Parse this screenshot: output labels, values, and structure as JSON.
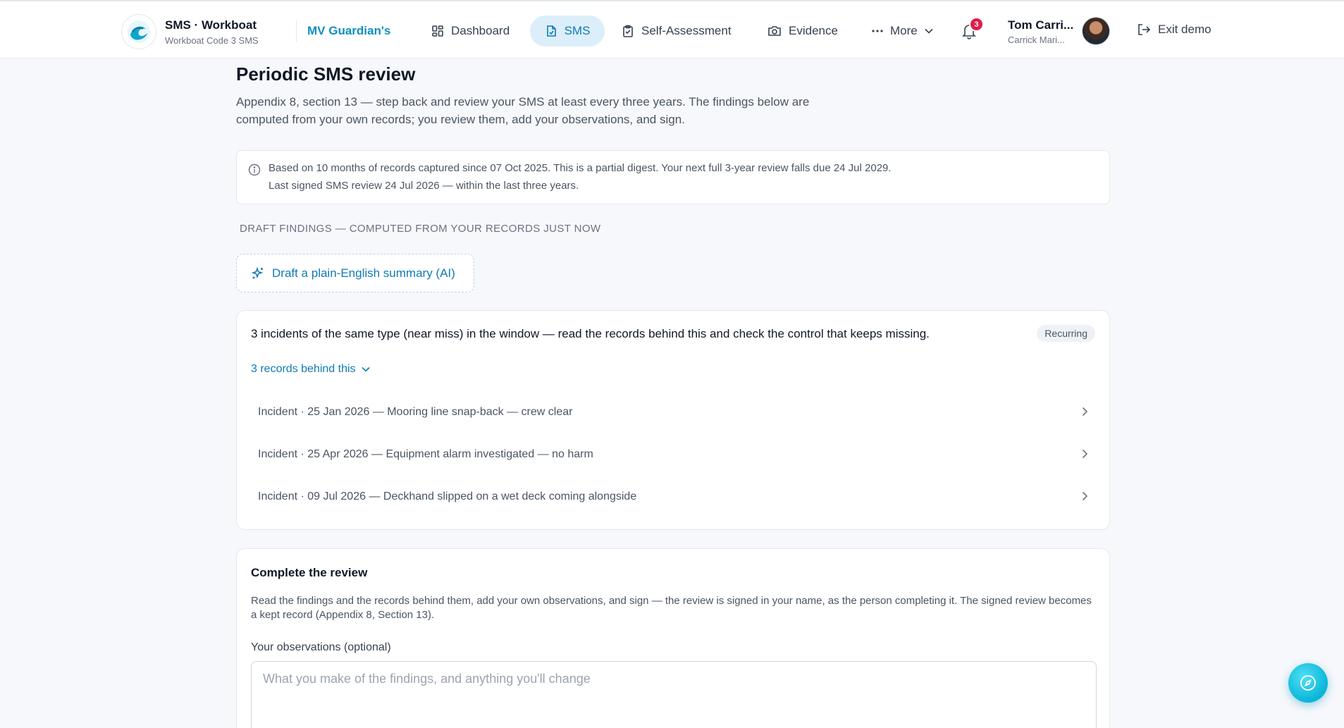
{
  "header": {
    "brand_title": "SMS · Workboat",
    "brand_subtitle": "Workboat Code 3 SMS",
    "vessel": "MV Guardian's",
    "nav": {
      "dashboard": "Dashboard",
      "sms": "SMS",
      "self_assessment": "Self-Assessment",
      "evidence": "Evidence",
      "more": "More"
    },
    "notifications_count": "3",
    "user_name": "Tom Carri...",
    "user_org": "Carrick Mari...",
    "exit": "Exit demo",
    "accent_color": "#0e7bb5",
    "icons": [
      "logo-wave-icon",
      "dashboard-grid-icon",
      "file-icon",
      "clipboard-check-icon",
      "camera-icon",
      "ellipsis-icon",
      "chevron-down-icon",
      "bell-icon",
      "logout-icon"
    ]
  },
  "page": {
    "title": "Periodic SMS review",
    "description": "Appendix 8, section 13 — step back and review your SMS at least every three years. The findings below are computed from your own records; you review them, add your observations, and sign.",
    "info_line1": "Based on 10 months of records captured since 07 Oct 2025. This is a partial digest. Your next full 3-year review falls due 24 Jul 2029.",
    "info_line2": "Last signed SMS review 24 Jul 2026 — within the last three years.",
    "section_label": "DRAFT FINDINGS — COMPUTED FROM YOUR RECORDS JUST NOW",
    "ai_button": "Draft a plain-English summary (AI)"
  },
  "finding": {
    "text": "3 incidents of the same type (near miss) in the window — read the records behind this and check the control that keeps missing.",
    "badge": "Recurring",
    "records_toggle": "3 records behind this",
    "records": [
      "Incident · 25 Jan 2026 — Mooring line snap-back — crew clear",
      "Incident · 25 Apr 2026 — Equipment alarm investigated — no harm",
      "Incident · 09 Jul 2026 — Deckhand slipped on a wet deck coming alongside"
    ]
  },
  "review": {
    "title": "Complete the review",
    "description": "Read the findings and the records behind them, add your own observations, and sign — the review is signed in your name, as the person completing it. The signed review becomes a kept record (Appendix 8, Section 13).",
    "observations_label": "Your observations (optional)",
    "observations_value": "",
    "observations_placeholder": "What you make of the findings, and anything you'll change"
  }
}
